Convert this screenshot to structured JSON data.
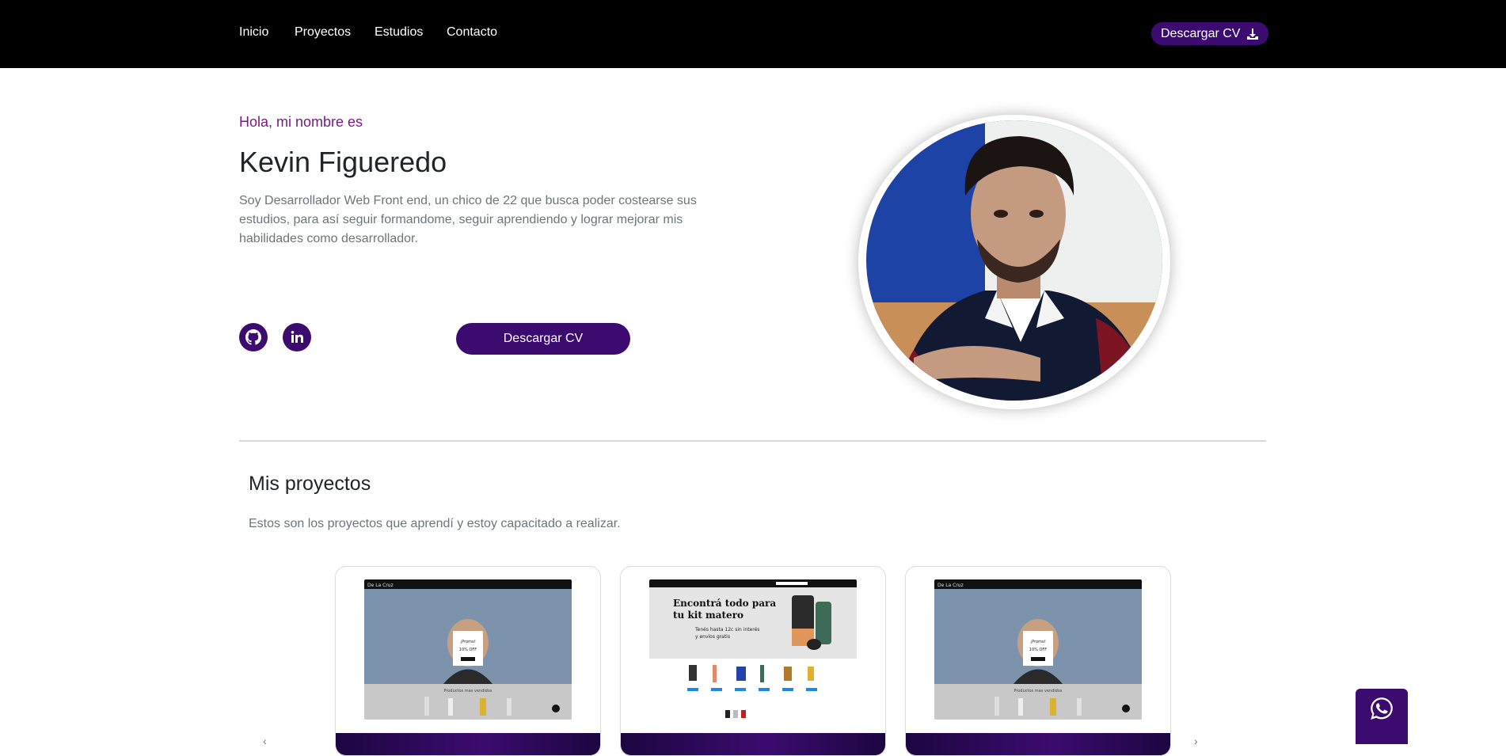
{
  "nav": {
    "links": [
      "Inicio",
      "Proyectos",
      "Estudios",
      "Contacto"
    ],
    "cv_label": "Descargar CV"
  },
  "hero": {
    "greeting": "Hola, mi nombre es",
    "name": "Kevin Figueredo",
    "description": "Soy Desarrollador Web Front end, un chico de 22 que busca poder costearse sus estudios, para así seguir formandome, seguir aprendiendo y lograr mejorar mis habilidades como desarrollador.",
    "cv_label": "Descargar CV",
    "social": [
      "github-icon",
      "linkedin-icon"
    ]
  },
  "projects": {
    "title": "Mis proyectos",
    "subtitle": "Estos son los proyectos que aprendí y estoy capacitado a realizar.",
    "cards": [
      {
        "shot_brand": "De La Cruz",
        "popup_title": "¡Promo!",
        "popup_offer": "10% OFF",
        "section": "Productos mas vendidos"
      },
      {
        "headline_1": "Encontrá todo para",
        "headline_2": "tu kit matero",
        "subline_1": "Tenés hasta 12c sin interés",
        "subline_2": "y envíos gratis"
      },
      {
        "shot_brand": "De La Cruz",
        "popup_title": "¡Promo!",
        "popup_offer": "10% OFF",
        "section": "Productos mas vendidos"
      }
    ]
  },
  "colors": {
    "accent": "#3b0b6f",
    "greeting": "#7a1a86",
    "nav_bg": "#000000"
  },
  "icons": [
    "download-icon",
    "github-icon",
    "linkedin-icon",
    "whatsapp-icon"
  ]
}
